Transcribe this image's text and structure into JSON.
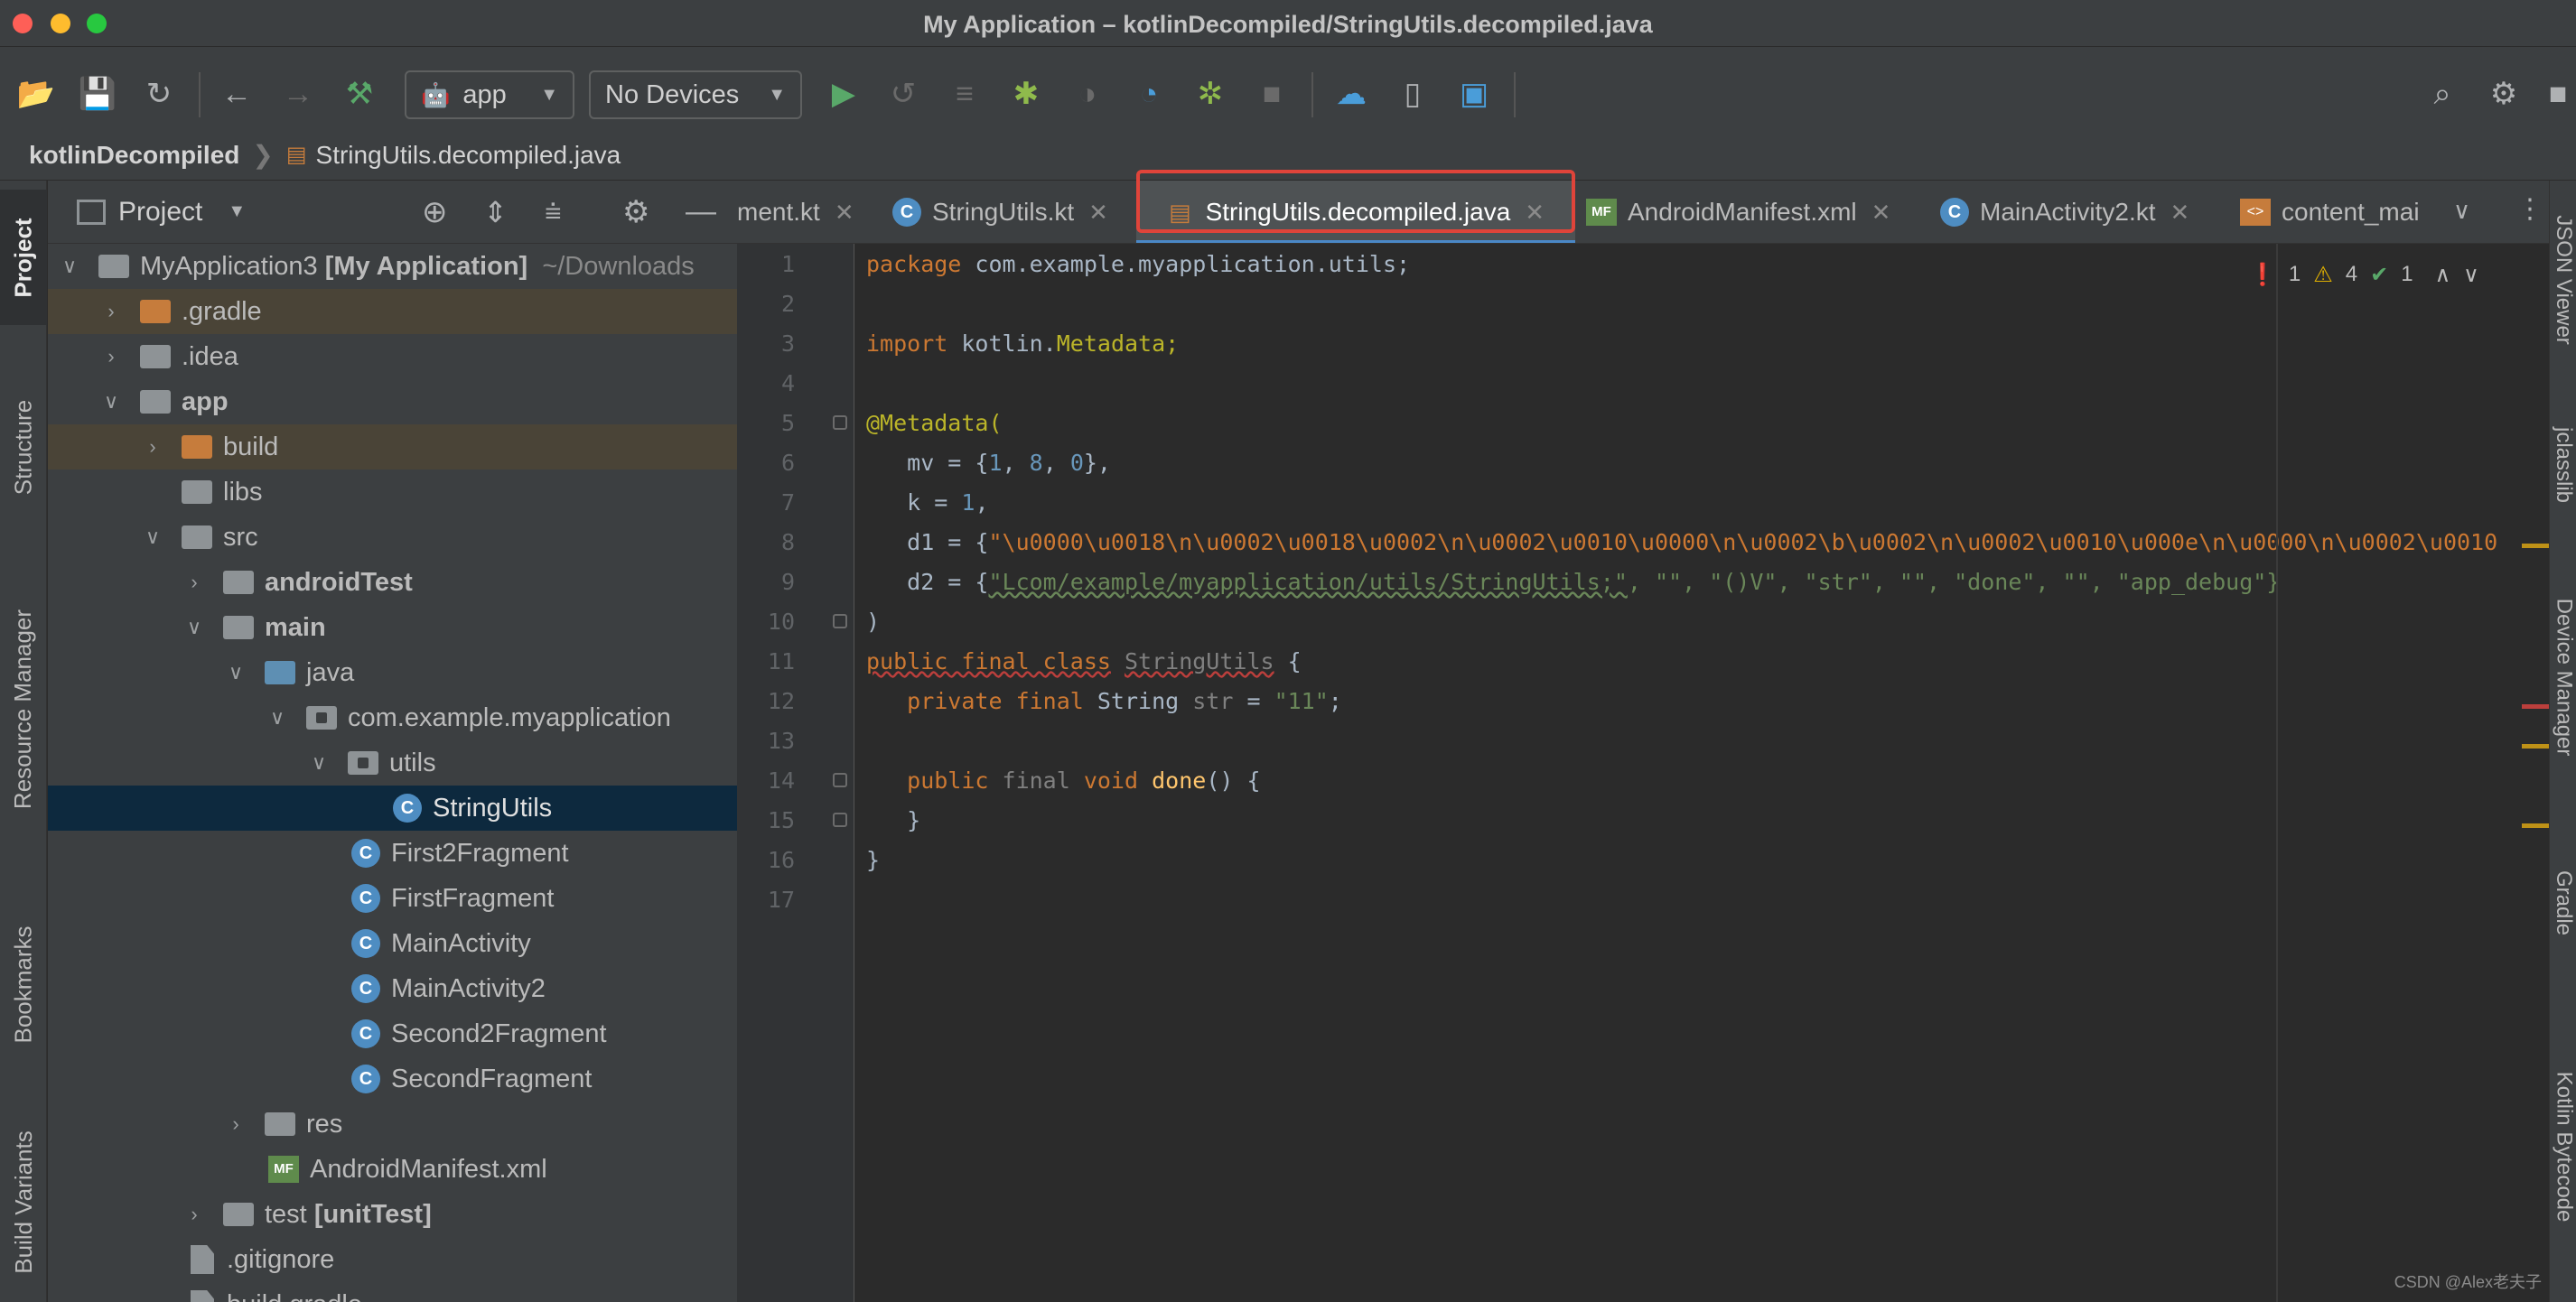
{
  "window": {
    "title": "My Application – kotlinDecompiled/StringUtils.decompiled.java"
  },
  "toolbar": {
    "run_config": "app",
    "device": "No Devices"
  },
  "breadcrumb": {
    "root": "kotlinDecompiled",
    "file": "StringUtils.decompiled.java"
  },
  "left_strip": {
    "tabs": [
      "Project",
      "Structure",
      "Resource Manager",
      "Bookmarks",
      "Build Variants"
    ]
  },
  "right_strip": {
    "tabs": [
      "JSON Viewer",
      "jclasslib",
      "Device Manager",
      "Gradle",
      "Kotlin Bytecode"
    ]
  },
  "project": {
    "header_label": "Project",
    "tree": [
      {
        "label": "MyApplication3",
        "bold_suffix": "[My Application]",
        "suffix": "~/Downloads"
      },
      {
        "label": ".gradle"
      },
      {
        "label": ".idea"
      },
      {
        "label": "app"
      },
      {
        "label": "build"
      },
      {
        "label": "libs"
      },
      {
        "label": "src"
      },
      {
        "label": "androidTest"
      },
      {
        "label": "main"
      },
      {
        "label": "java"
      },
      {
        "label": "com.example.myapplication"
      },
      {
        "label": "utils"
      },
      {
        "label": "StringUtils"
      },
      {
        "label": "First2Fragment"
      },
      {
        "label": "FirstFragment"
      },
      {
        "label": "MainActivity"
      },
      {
        "label": "MainActivity2"
      },
      {
        "label": "Second2Fragment"
      },
      {
        "label": "SecondFragment"
      },
      {
        "label": "res"
      },
      {
        "label": "AndroidManifest.xml"
      },
      {
        "label": "test",
        "bold_suffix": "[unitTest]"
      },
      {
        "label": ".gitignore"
      },
      {
        "label": "build.gradle"
      }
    ]
  },
  "editor_tabs": [
    {
      "label": "ment.kt"
    },
    {
      "label": "StringUtils.kt"
    },
    {
      "label": "StringUtils.decompiled.java"
    },
    {
      "label": "AndroidManifest.xml"
    },
    {
      "label": "MainActivity2.kt"
    },
    {
      "label": "content_mai"
    }
  ],
  "inspections": {
    "errors": "1",
    "warnings": "4",
    "ok": "1"
  },
  "code": {
    "line_numbers": [
      "1",
      "2",
      "3",
      "4",
      "5",
      "6",
      "7",
      "8",
      "9",
      "10",
      "11",
      "12",
      "13",
      "14",
      "15",
      "16",
      "17"
    ],
    "package_kw": "package",
    "package_name": "com.example.myapplication.utils;",
    "import_kw": "import",
    "import_name": "kotlin.",
    "import_class": "Metadata;",
    "metadata_ann": "@Metadata(",
    "mv_lhs": "mv = {",
    "mv_1": "1",
    "mv_2": "8",
    "mv_3": "0",
    "mv_end": "},",
    "k_lhs": "k = ",
    "k_val": "1",
    "k_end": ",",
    "d1_lhs": "d1 = {",
    "d1_val": "\"\\u0000\\u0018\\n\\u0002\\u0018\\u0002\\n\\u0002\\u0010\\u0000\\n\\u0002\\b\\u0002\\n\\u0002\\u0010\\u000e\\n\\u0000\\n\\u0002\\u0010",
    "d2_lhs": "d2 = {",
    "d2_first": "\"Lcom/example/myapplication/utils/StringUtils;\"",
    "d2_rest": ", \"\", \"()V\", \"str\", \"\", \"done\", \"\", \"app_debug\"}",
    "close_paren": ")",
    "class_kw": "public final class",
    "class_name": "StringUtils",
    "class_brace": " {",
    "field_kw": "private final",
    "field_type": " String ",
    "field_name": "str",
    "field_eq": " = ",
    "field_val": "\"11\"",
    "field_end": ";",
    "method_kw": "public",
    "method_final": " final ",
    "method_void": "void ",
    "method_name": "done",
    "method_sig": "() {",
    "inner_close": "}",
    "outer_close": "}"
  },
  "watermark": "CSDN @Alex老夫子",
  "colors": {
    "accent_tab": "#4a88c7",
    "highlight_box": "#e0443a",
    "selection": "#0d293e"
  }
}
